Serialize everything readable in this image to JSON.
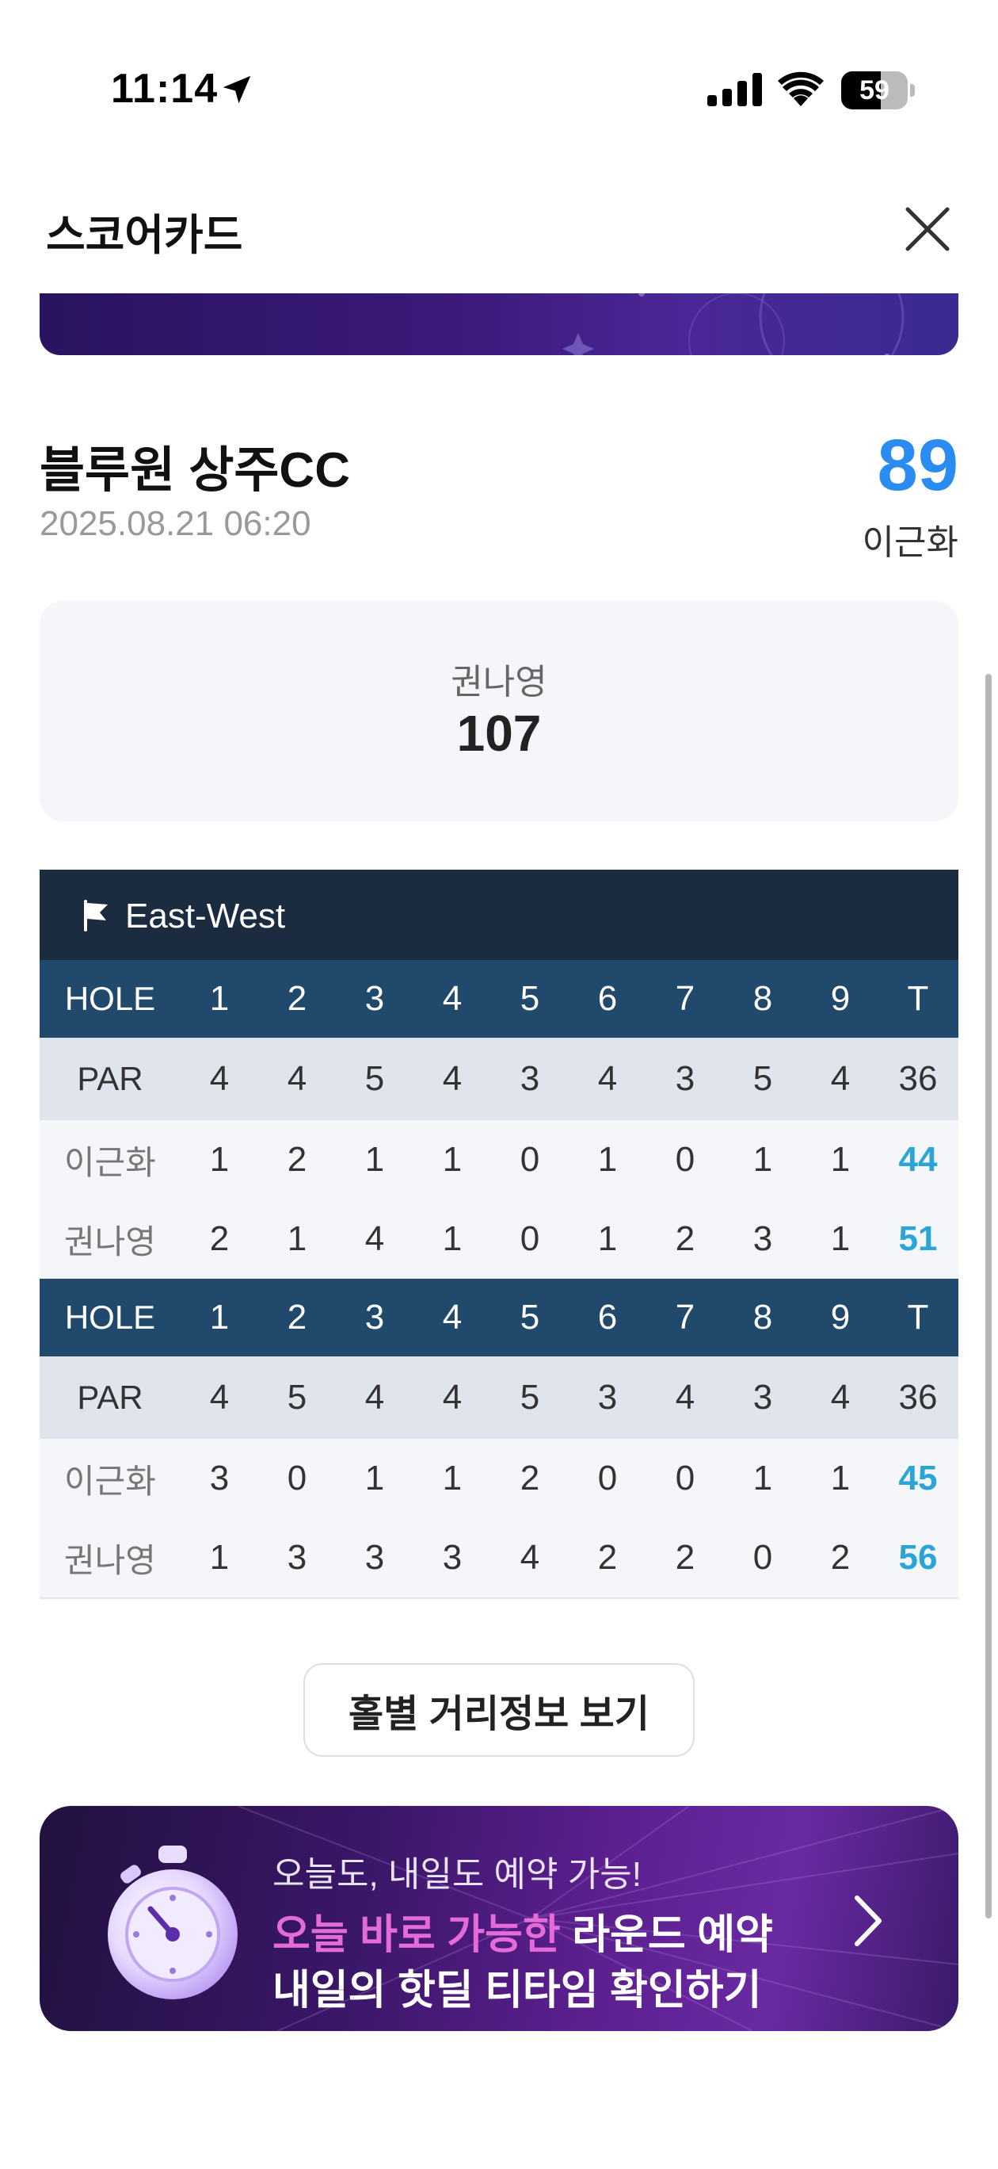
{
  "status_bar": {
    "time": "11:14",
    "battery": "59",
    "battery_level_percent": 59,
    "icons": [
      "location-arrow-icon",
      "signal-icon",
      "wifi-icon",
      "battery-icon"
    ]
  },
  "header": {
    "title": "스코어카드",
    "close_icon": "close-icon"
  },
  "round": {
    "course_name": "블루원 상주CC",
    "date": "2025.08.21 06:20",
    "my_score": "89",
    "my_name": "이근화"
  },
  "opponent": {
    "name": "권나영",
    "score": "107"
  },
  "scorecard": {
    "course_label": "East-West",
    "flag_icon": "flag-icon",
    "blocks": [
      {
        "hole_row": {
          "label": "HOLE",
          "cells": [
            "1",
            "2",
            "3",
            "4",
            "5",
            "6",
            "7",
            "8",
            "9"
          ],
          "total": "T"
        },
        "par_row": {
          "label": "PAR",
          "cells": [
            "4",
            "4",
            "5",
            "4",
            "3",
            "4",
            "3",
            "5",
            "4"
          ],
          "total": "36"
        },
        "players": [
          {
            "label": "이근화",
            "cells": [
              "1",
              "2",
              "1",
              "1",
              "0",
              "1",
              "0",
              "1",
              "1"
            ],
            "total": "44"
          },
          {
            "label": "권나영",
            "cells": [
              "2",
              "1",
              "4",
              "1",
              "0",
              "1",
              "2",
              "3",
              "1"
            ],
            "total": "51"
          }
        ]
      },
      {
        "hole_row": {
          "label": "HOLE",
          "cells": [
            "1",
            "2",
            "3",
            "4",
            "5",
            "6",
            "7",
            "8",
            "9"
          ],
          "total": "T"
        },
        "par_row": {
          "label": "PAR",
          "cells": [
            "4",
            "5",
            "4",
            "4",
            "5",
            "3",
            "4",
            "3",
            "4"
          ],
          "total": "36"
        },
        "players": [
          {
            "label": "이근화",
            "cells": [
              "3",
              "0",
              "1",
              "1",
              "2",
              "0",
              "0",
              "1",
              "1"
            ],
            "total": "45"
          },
          {
            "label": "권나영",
            "cells": [
              "1",
              "3",
              "3",
              "3",
              "4",
              "2",
              "2",
              "0",
              "2"
            ],
            "total": "56"
          }
        ]
      }
    ]
  },
  "distance_button": {
    "label": "홀별 거리정보 보기"
  },
  "promo_banner": {
    "line1": "오늘도, 내일도 예약 가능!",
    "line2_highlight": "오늘 바로 가능한",
    "line2_rest": " 라운드 예약",
    "line3": "내일의 핫딜 티타임 확인하기",
    "icon": "stopwatch-icon",
    "arrow_icon": "chevron-right-icon",
    "colors": {
      "highlight": "#e56bd8",
      "background": "#5b1f8e"
    }
  },
  "colors": {
    "accent_score": "#2a8cf0",
    "total_score": "#2ba4d8",
    "hole_row_bg": "#21496c",
    "course_bar_bg": "#1b2b40"
  }
}
